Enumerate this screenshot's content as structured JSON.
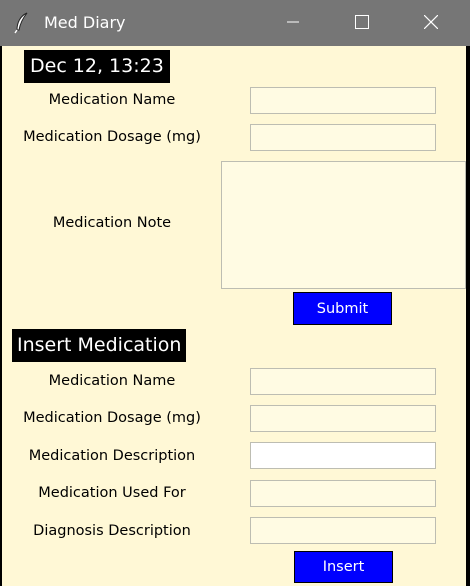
{
  "window": {
    "title": "Med Diary",
    "icons": [
      "feather-icon",
      "minimize-icon",
      "maximize-icon",
      "close-icon"
    ]
  },
  "header": {
    "datetime": "Dec 12, 13:23"
  },
  "note_form": {
    "name_label": "Medication Name",
    "name_value": "",
    "dosage_label": "Medication Dosage (mg)",
    "dosage_value": "",
    "note_label": "Medication Note",
    "note_value": "",
    "submit_label": "Submit"
  },
  "insert_form": {
    "heading": "Insert Medication",
    "name_label": "Medication Name",
    "name_value": "",
    "dosage_label": "Medication Dosage (mg)",
    "dosage_value": "",
    "description_label": "Medication Description",
    "description_value": "",
    "used_for_label": "Medication Used For",
    "used_for_value": "",
    "diagnosis_label": "Diagnosis Description",
    "diagnosis_value": "",
    "insert_label": "Insert"
  },
  "colors": {
    "titlebar": "#767676",
    "background": "#fff8d6",
    "field": "#fffbe3",
    "heading": "#000000",
    "button": "#0000ff"
  }
}
